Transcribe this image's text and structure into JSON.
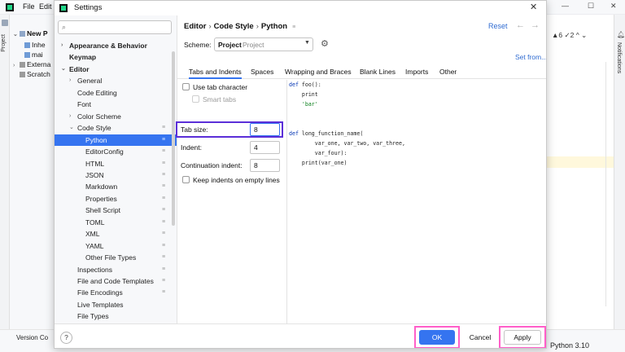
{
  "ide": {
    "menu": [
      "File",
      "Edit"
    ],
    "project_label": "Project",
    "tree": [
      {
        "label": "New P",
        "arrow": "⌄",
        "bold": true
      },
      {
        "label": "Inhe",
        "arrow": ""
      },
      {
        "label": "mai",
        "arrow": ""
      },
      {
        "label": "Externa",
        "arrow": "›"
      },
      {
        "label": "Scratch",
        "arrow": ""
      }
    ],
    "right_toolbar": "▲6  ✓2  ^  ⌄",
    "notifications_label": "Notifications",
    "status_left": "Version Co",
    "status_right": "Python 3.10"
  },
  "dialog": {
    "title": "Settings",
    "close": "✕",
    "search_placeholder": "",
    "nav": [
      {
        "label": "Appearance & Behavior",
        "arrow": "›",
        "bold": true,
        "badge": ""
      },
      {
        "label": "Keymap",
        "arrow": "",
        "bold": true,
        "badge": ""
      },
      {
        "label": "Editor",
        "arrow": "⌄",
        "bold": true,
        "badge": ""
      },
      {
        "label": "General",
        "arrow": "›",
        "bold": false,
        "badge": ""
      },
      {
        "label": "Code Editing",
        "arrow": "",
        "bold": false,
        "badge": ""
      },
      {
        "label": "Font",
        "arrow": "",
        "bold": false,
        "badge": ""
      },
      {
        "label": "Color Scheme",
        "arrow": "›",
        "bold": false,
        "badge": ""
      },
      {
        "label": "Code Style",
        "arrow": "⌄",
        "bold": false,
        "badge": "≡"
      },
      {
        "label": "Python",
        "arrow": "",
        "bold": false,
        "badge": "≡",
        "selected": true
      },
      {
        "label": "EditorConfig",
        "arrow": "",
        "bold": false,
        "badge": "≡"
      },
      {
        "label": "HTML",
        "arrow": "",
        "bold": false,
        "badge": "≡"
      },
      {
        "label": "JSON",
        "arrow": "",
        "bold": false,
        "badge": "≡"
      },
      {
        "label": "Markdown",
        "arrow": "",
        "bold": false,
        "badge": "≡"
      },
      {
        "label": "Properties",
        "arrow": "",
        "bold": false,
        "badge": "≡"
      },
      {
        "label": "Shell Script",
        "arrow": "",
        "bold": false,
        "badge": "≡"
      },
      {
        "label": "TOML",
        "arrow": "",
        "bold": false,
        "badge": "≡"
      },
      {
        "label": "XML",
        "arrow": "",
        "bold": false,
        "badge": "≡"
      },
      {
        "label": "YAML",
        "arrow": "",
        "bold": false,
        "badge": "≡"
      },
      {
        "label": "Other File Types",
        "arrow": "",
        "bold": false,
        "badge": "≡"
      },
      {
        "label": "Inspections",
        "arrow": "",
        "bold": false,
        "badge": "≡"
      },
      {
        "label": "File and Code Templates",
        "arrow": "",
        "bold": false,
        "badge": "≡"
      },
      {
        "label": "File Encodings",
        "arrow": "",
        "bold": false,
        "badge": "≡"
      },
      {
        "label": "Live Templates",
        "arrow": "",
        "bold": false,
        "badge": ""
      },
      {
        "label": "File Types",
        "arrow": "",
        "bold": false,
        "badge": ""
      }
    ],
    "breadcrumb": [
      "Editor",
      "Code Style",
      "Python"
    ],
    "breadcrumb_sep": "›",
    "breadcrumb_badge": "≡",
    "reset_label": "Reset",
    "back_arrow": "←",
    "forward_arrow": "→",
    "scheme_label": "Scheme:",
    "scheme_value": "Project",
    "scheme_type": "Project",
    "set_from_label": "Set from...",
    "tabs": [
      "Tabs and Indents",
      "Spaces",
      "Wrapping and Braces",
      "Blank Lines",
      "Imports",
      "Other"
    ],
    "active_tab": "Tabs and Indents",
    "use_tab_character": "Use tab character",
    "smart_tabs": "Smart tabs",
    "tab_size_label": "Tab size:",
    "tab_size_value": "8",
    "indent_label": "Indent:",
    "indent_value": "4",
    "continuation_indent_label": "Continuation indent:",
    "continuation_indent_value": "8",
    "keep_indents_label": "Keep indents on empty lines",
    "code_preview": [
      "def foo():",
      "    print",
      "    'bar'",
      "",
      "",
      "def long_function_name(",
      "        var_one, var_two, var_three,",
      "        var_four):",
      "    print(var_one)"
    ],
    "help_label": "?",
    "ok_label": "OK",
    "cancel_label": "Cancel",
    "apply_label": "Apply"
  },
  "colors": {
    "accent": "#3574f0",
    "tab_size_highlight": "#5b2fd8",
    "button_highlight": "#ff5fc9"
  }
}
